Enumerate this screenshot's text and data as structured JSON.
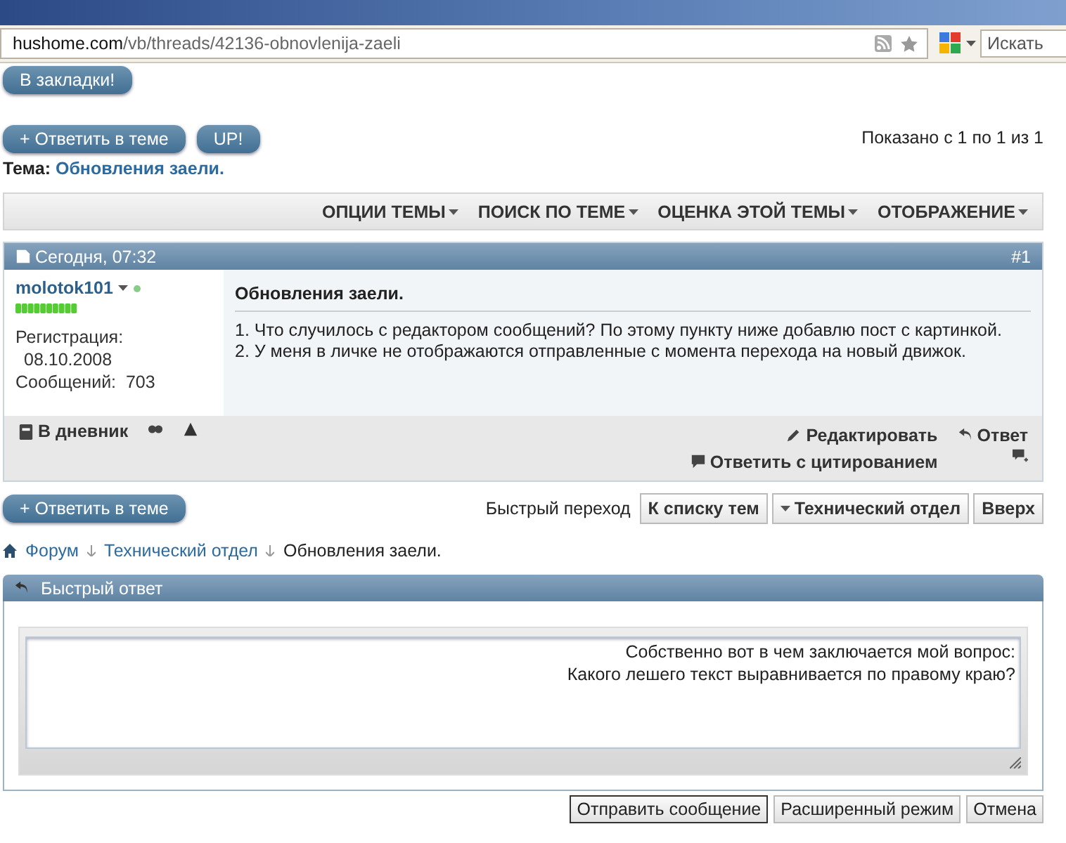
{
  "browser": {
    "url_host": "hushome.com",
    "url_path": "/vb/threads/42136-obnovlenija-zaeli",
    "search": {
      "placeholder": "Искать"
    }
  },
  "bookmark_button": "В закладки!",
  "top_buttons": [
    "+ Ответить в теме",
    "UP!"
  ],
  "pagination": "Показано с 1 по 1 из 1",
  "thread": {
    "label": "Тема:",
    "title": "Обновления заели."
  },
  "thread_menu": [
    "ОПЦИИ ТЕМЫ",
    "ПОИСК ПО ТЕМЕ",
    "ОЦЕНКА ЭТОЙ ТЕМЫ",
    "ОТОБРАЖЕНИЕ"
  ],
  "post": {
    "date": "Сегодня, 07:32",
    "number": "#1",
    "author": "molotok101",
    "online": true,
    "reg_label": "Регистрация:",
    "reg_date": "08.10.2008",
    "posts_label": "Сообщений:",
    "posts_count": "703",
    "title": "Обновления заели.",
    "lines": [
      "1. Что случилось с редактором сообщений? По этому пункту ниже добавлю пост с картинкой.",
      "2. У меня в личке не отображаются отправленные с момента перехода на новый движок."
    ],
    "diary": "В дневник",
    "edit": "Редактировать",
    "reply": "Ответ",
    "quote": "Ответить с цитированием"
  },
  "reply_button": "+ Ответить в теме",
  "quick_nav": {
    "label": "Быстрый переход",
    "list": "К списку тем",
    "forum": "Технический отдел",
    "top": "Вверх"
  },
  "breadcrumbs": [
    {
      "text": "Форум",
      "link": true
    },
    {
      "text": "Технический отдел",
      "link": true
    },
    {
      "text": "Обновления заели.",
      "link": false
    }
  ],
  "quick_reply": {
    "title": "Быстрый ответ",
    "lines": [
      "Собственно вот в чем заключается мой вопрос:",
      "Какого лешего текст выравнивается по правому краю?"
    ],
    "buttons": [
      "Отправить сообщение",
      "Расширенный режим",
      "Отмена"
    ]
  }
}
